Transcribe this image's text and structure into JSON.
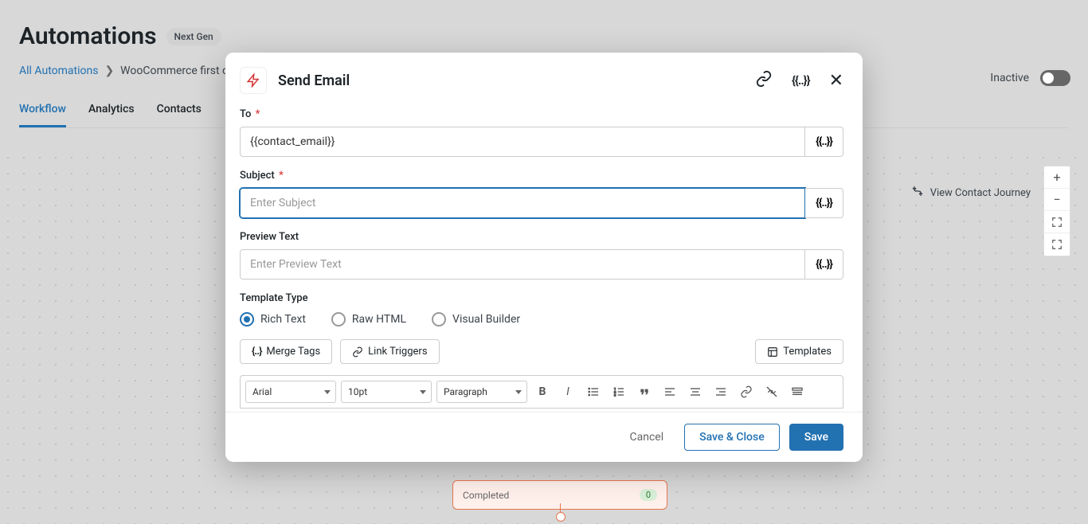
{
  "page": {
    "title": "Automations",
    "badge": "Next Gen"
  },
  "breadcrumb": {
    "root": "All Automations",
    "current": "WooCommerce first ord"
  },
  "tabs": [
    "Workflow",
    "Analytics",
    "Contacts"
  ],
  "status": {
    "label": "Inactive"
  },
  "canvas": {
    "view_journey": "View Contact Journey",
    "node_label": "Completed",
    "node_count": "0"
  },
  "modal": {
    "title": "Send Email",
    "fields": {
      "to_label": "To",
      "to_value": "{{contact_email}}",
      "subject_label": "Subject",
      "subject_placeholder": "Enter Subject",
      "preview_label": "Preview Text",
      "preview_placeholder": "Enter Preview Text",
      "template_label": "Template Type"
    },
    "template_options": [
      "Rich Text",
      "Raw HTML",
      "Visual Builder"
    ],
    "toolbar": {
      "merge_tags": "Merge Tags",
      "link_triggers": "Link Triggers",
      "templates": "Templates"
    },
    "editor": {
      "font": "Arial",
      "size": "10pt",
      "format": "Paragraph"
    },
    "footer": {
      "cancel": "Cancel",
      "save_close": "Save & Close",
      "save": "Save"
    }
  }
}
